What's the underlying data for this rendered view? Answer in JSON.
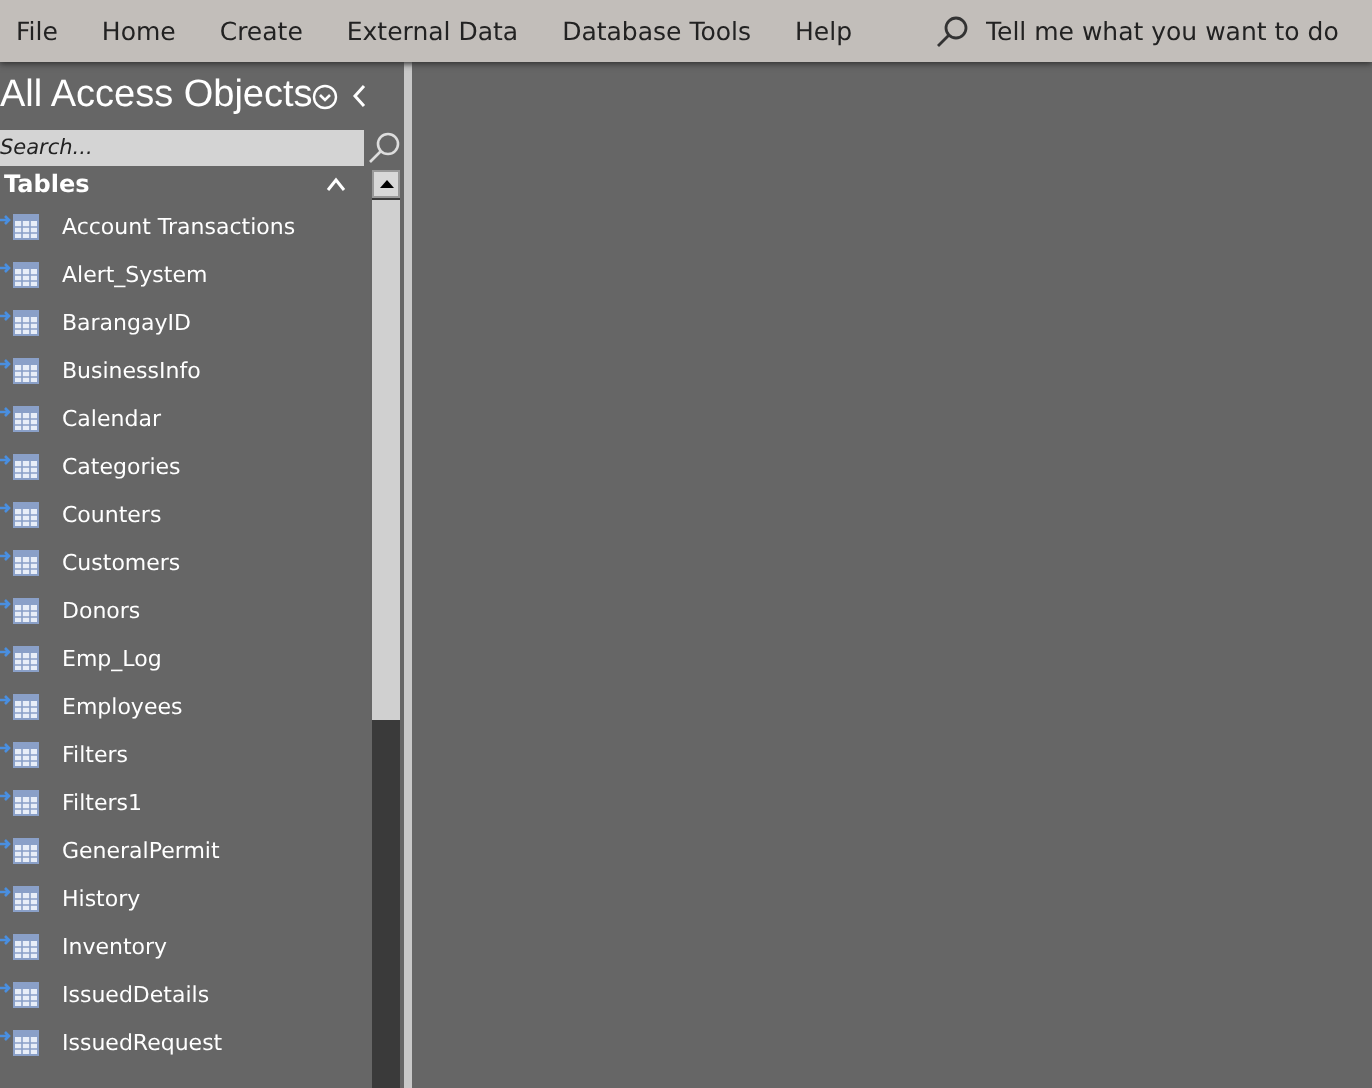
{
  "menu": [
    "File",
    "Home",
    "Create",
    "External Data",
    "Database Tools",
    "Help"
  ],
  "tell_me": {
    "placeholder": "Tell me what you want to do"
  },
  "nav_pane": {
    "title": "All Access Objects",
    "search": {
      "placeholder": "Search..."
    },
    "groups": [
      {
        "label": "Tables",
        "expanded": true,
        "items": [
          {
            "label": "Account Transactions",
            "linked": true
          },
          {
            "label": "Alert_System",
            "linked": true
          },
          {
            "label": "BarangayID",
            "linked": true
          },
          {
            "label": "BusinessInfo",
            "linked": true
          },
          {
            "label": "Calendar",
            "linked": true
          },
          {
            "label": "Categories",
            "linked": true
          },
          {
            "label": "Counters",
            "linked": true
          },
          {
            "label": "Customers",
            "linked": true
          },
          {
            "label": "Donors",
            "linked": true
          },
          {
            "label": "Emp_Log",
            "linked": true
          },
          {
            "label": "Employees",
            "linked": true
          },
          {
            "label": "Filters",
            "linked": true
          },
          {
            "label": "Filters1",
            "linked": true
          },
          {
            "label": "GeneralPermit",
            "linked": true
          },
          {
            "label": "History",
            "linked": true
          },
          {
            "label": "Inventory",
            "linked": true
          },
          {
            "label": "IssuedDetails",
            "linked": true
          },
          {
            "label": "IssuedRequest",
            "linked": true
          }
        ]
      }
    ]
  }
}
